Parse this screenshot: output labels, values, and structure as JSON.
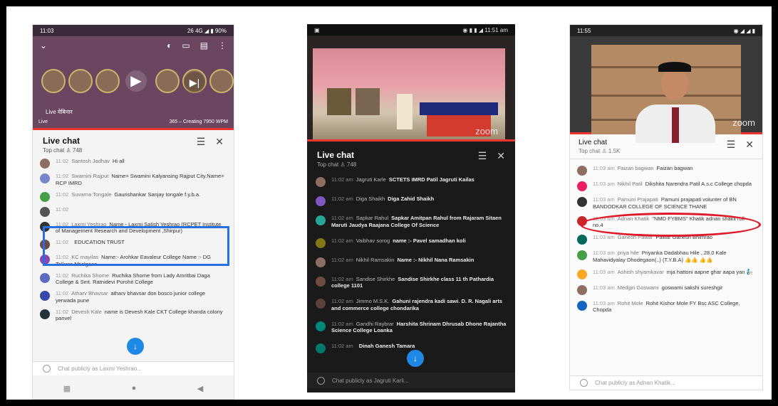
{
  "phone1": {
    "status": {
      "time": "11:03",
      "right": "26 4G ◢ ▮ 90%"
    },
    "video": {
      "caption": "Live वेबिनार",
      "caption2": "Live",
      "bottom_right": "365 – Creating 7950 WPM"
    },
    "chat": {
      "title": "Live chat",
      "subtitle": "Top chat",
      "viewers": "748",
      "messages": [
        {
          "time": "11:02",
          "author": "Santosh Jadhav",
          "text": "Hi all",
          "color": "#8d6e63"
        },
        {
          "time": "11:02",
          "author": "Swamini Rajput",
          "text": "Name= Swamini Kalyansing Rajput City.Name= RCP IMRD",
          "color": "#7986cb"
        },
        {
          "time": "11:02",
          "author": "Suvarna Tongale",
          "text": "Gaurishankar Sanjay tongale f.y.b.a.",
          "color": "#43a047"
        },
        {
          "time": "11:02",
          "author": "",
          "text": "",
          "color": "#555"
        },
        {
          "time": "11:02",
          "author": "Laxmi Yeshrao",
          "text": "Name - Laxmi Satish Yeshrao (RCPET Institute of Management Research and Development ,Shirpur)",
          "color": "#333"
        },
        {
          "time": "11:02",
          "author": "",
          "text": "EDUCATION TRUST",
          "color": "#6d4c41"
        },
        {
          "time": "11:02",
          "author": "KC mayilas",
          "text": "Name:- Arohkar Eavaleur College Name :- DG Tolkare Nhalgaon",
          "color": "#8e44ad"
        },
        {
          "time": "11:02",
          "author": "Ruchika Shome",
          "text": "Ruchika Shome from Lady Amritbai Daga College & Smt. Ratnidevi Purohit College",
          "color": "#5c6bc0"
        },
        {
          "time": "11:02",
          "author": "Atharv Bhavsar",
          "text": "atharv bhavsar don bosco junior college yerwada pune",
          "color": "#3949ab"
        },
        {
          "time": "11:02",
          "author": "Devesh Kale",
          "text": "name is Devesh Kale CKT College khanda colony panvel",
          "color": "#263238"
        }
      ],
      "input_placeholder": "Chat publicly as Laxmi Yeshrao..."
    }
  },
  "phone2": {
    "status": {
      "time": "",
      "right": "◉ ▮ ▮ ◢ 11:51 am"
    },
    "video": {
      "watermark": "zoom"
    },
    "chat": {
      "title": "Live chat",
      "subtitle": "Top chat",
      "viewers": "748",
      "messages": [
        {
          "time": "11:02 am",
          "author": "Jagruti Karle",
          "text": "SCTETS IMRD Patil Jagruti Kailas",
          "color": "#8d6e63"
        },
        {
          "time": "11:02 am",
          "author": "Diga Shaikh",
          "text": "Diga Zahid Shaikh",
          "color": "#7e57c2"
        },
        {
          "time": "11:02 am",
          "author": "Sapkar Rahul",
          "text": "Sapkar Amitpan Rahul from Rajaram Sitaen Maruti Jaudya Raajana College Of Science",
          "color": "#26a69a"
        },
        {
          "time": "11:02 am",
          "author": "Vaibhav sorog",
          "text": "name :- Pavel samadhan koli",
          "color": "#827717"
        },
        {
          "time": "11:02 am",
          "author": "Nikhil Ramsakin",
          "text": "Name :- Nikhil Nana Ramsakin",
          "color": "#8d6e63"
        },
        {
          "time": "11:02 am",
          "author": "Sandise Shirkhe",
          "text": "Sandise Shirkhe class 11 th Pathardia college 1101",
          "color": "#6d4c41"
        },
        {
          "time": "11:02 am",
          "author": "Jimmo M.S.K.",
          "text": "Gahuni rajendra kadi sawi. D. R. Nagali arts and commerce college chondarika",
          "color": "#5d4037"
        },
        {
          "time": "11:02 am",
          "author": "Gandhi Raybrar",
          "text": "Harshita Shrinam Dhrusab Dhone Rajantha Science College Loanka",
          "color": "#00897b"
        },
        {
          "time": "11:02 am",
          "author": "",
          "text": "Dinah Ganesh Tamara",
          "color": "#00796b"
        }
      ],
      "input_placeholder": "Chat publicly as Jagruti Karli..."
    }
  },
  "phone3": {
    "status": {
      "time": "11:55",
      "right": "◉ ◢ ◢ ▮"
    },
    "video": {
      "watermark": "zoom"
    },
    "chat": {
      "title": "Live chat",
      "subtitle": "Top chat",
      "viewers": "1.5K",
      "messages": [
        {
          "time": "11:03 am",
          "author": "Faizan bagwan",
          "text": "Faizan bagwan",
          "color": "#8d6e63"
        },
        {
          "time": "11:03 am",
          "author": "Nikhil Patil",
          "text": "Dikshita Narendra Patil A.s.c College chopda",
          "color": "#e91e63"
        },
        {
          "time": "11:03 am",
          "author": "Pamuni Prajapati",
          "text": "Pamuni prajapati volunter of BN BANDODKAR COLLEGE OF SCIENCE THANE",
          "color": "#333"
        },
        {
          "time": "11:03 am",
          "author": "Adnan Khatik",
          "text": "\"NMD FYBMS\" Khatik adnan shakil roll no.4",
          "color": "#c62828"
        },
        {
          "time": "11:03 am",
          "author": "Ganesh Pawar",
          "text": "Pawar Ganesh Bhimrao",
          "color": "#00695c"
        },
        {
          "time": "11:03 am",
          "author": "priya hile",
          "text": "Priyanka Dadabhau Hile , 28.0 Kale Mahavidyalay Dhodegaon(..) (T.Y.B.A) 👍👍 👍👍",
          "color": "#43a047"
        },
        {
          "time": "11:03 am",
          "author": "Ashish shyamkavar",
          "text": "mja hattoni aapne ghar aapa yan 🧞",
          "color": "#f9a825"
        },
        {
          "time": "11:03 am",
          "author": "Medgiri Goswami",
          "text": "goswami sakshi sureshgir",
          "color": "#8d6e63"
        },
        {
          "time": "11:03 am",
          "author": "Rohit Mole",
          "text": "Rohit Kishor Mole FY Bsc ASC College, Chopda",
          "color": "#1565c0"
        }
      ],
      "input_placeholder": "Chat publicly as Adnan Khatik..."
    }
  },
  "colors": {
    "highlight_box": "#2a6fe0",
    "highlight_oval": "#e0192a",
    "fab": "#1e88e5",
    "progress": "#ee3333"
  }
}
